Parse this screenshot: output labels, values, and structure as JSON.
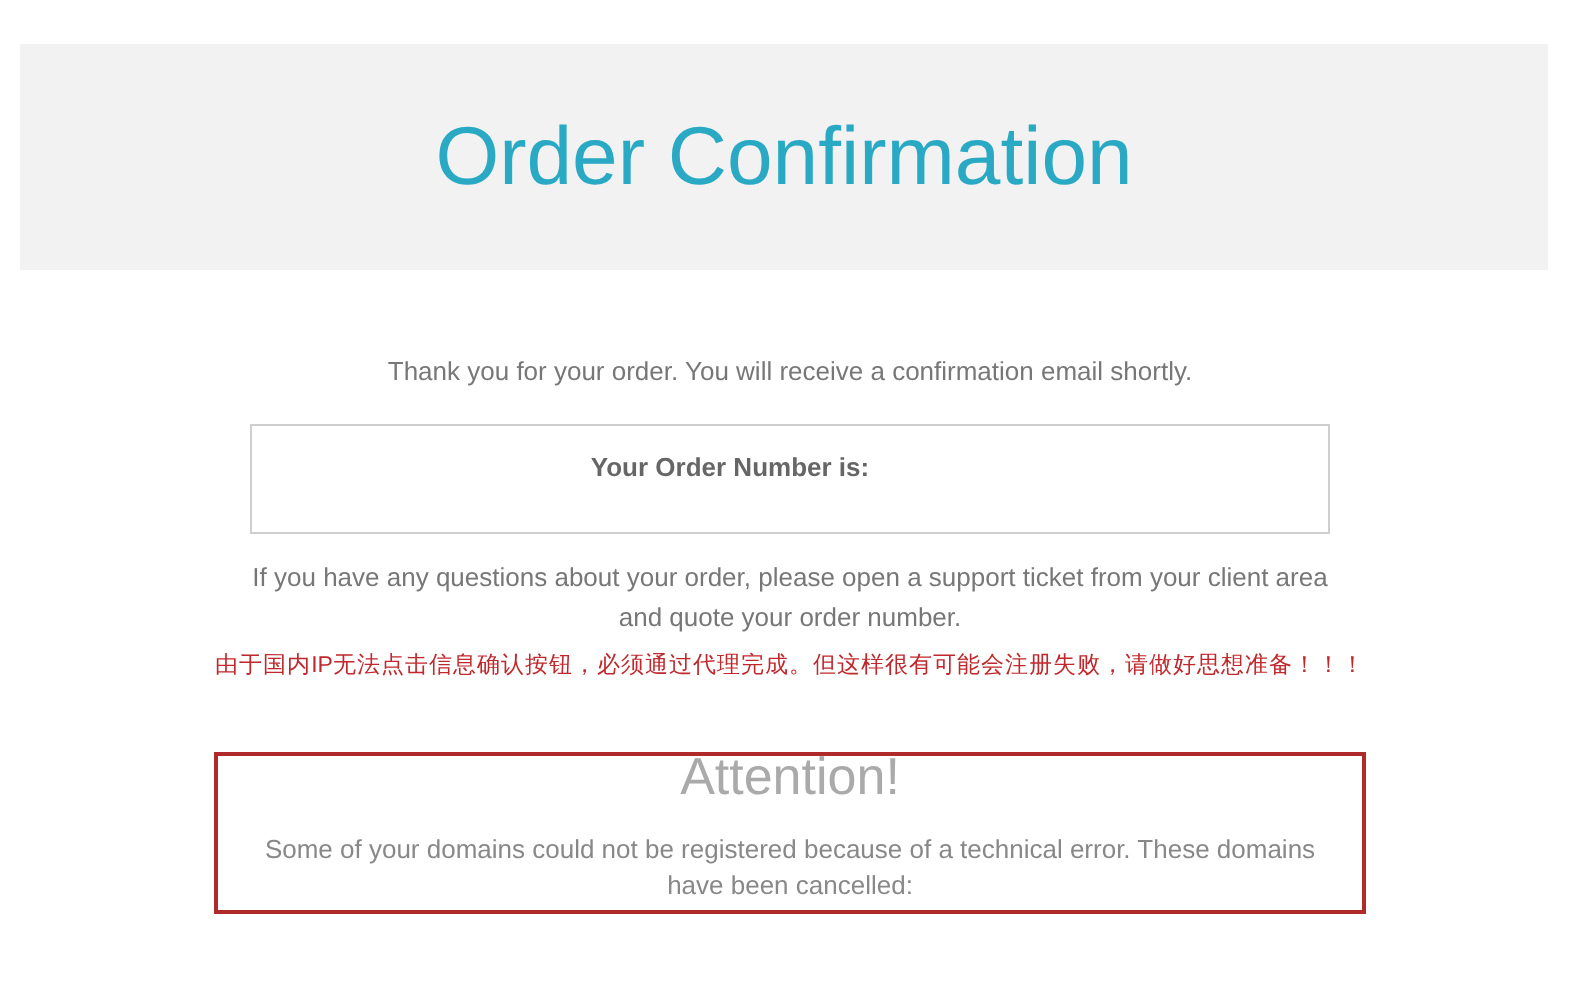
{
  "header": {
    "title": "Order Confirmation"
  },
  "thank_you": "Thank you for your order. You will receive a confirmation email shortly.",
  "order_number_box": {
    "label": "Your Order Number is:"
  },
  "support_note": "If you have any questions about your order, please open a support ticket from your client area and quote your order number.",
  "warning_note": "由于国内IP无法点击信息确认按钮，必须通过代理完成。但这样很有可能会注册失败，请做好思想准备！！！",
  "attention": {
    "title": "Attention!",
    "message": "Some of your domains could not be registered because of a technical error. These domains have been cancelled:"
  }
}
